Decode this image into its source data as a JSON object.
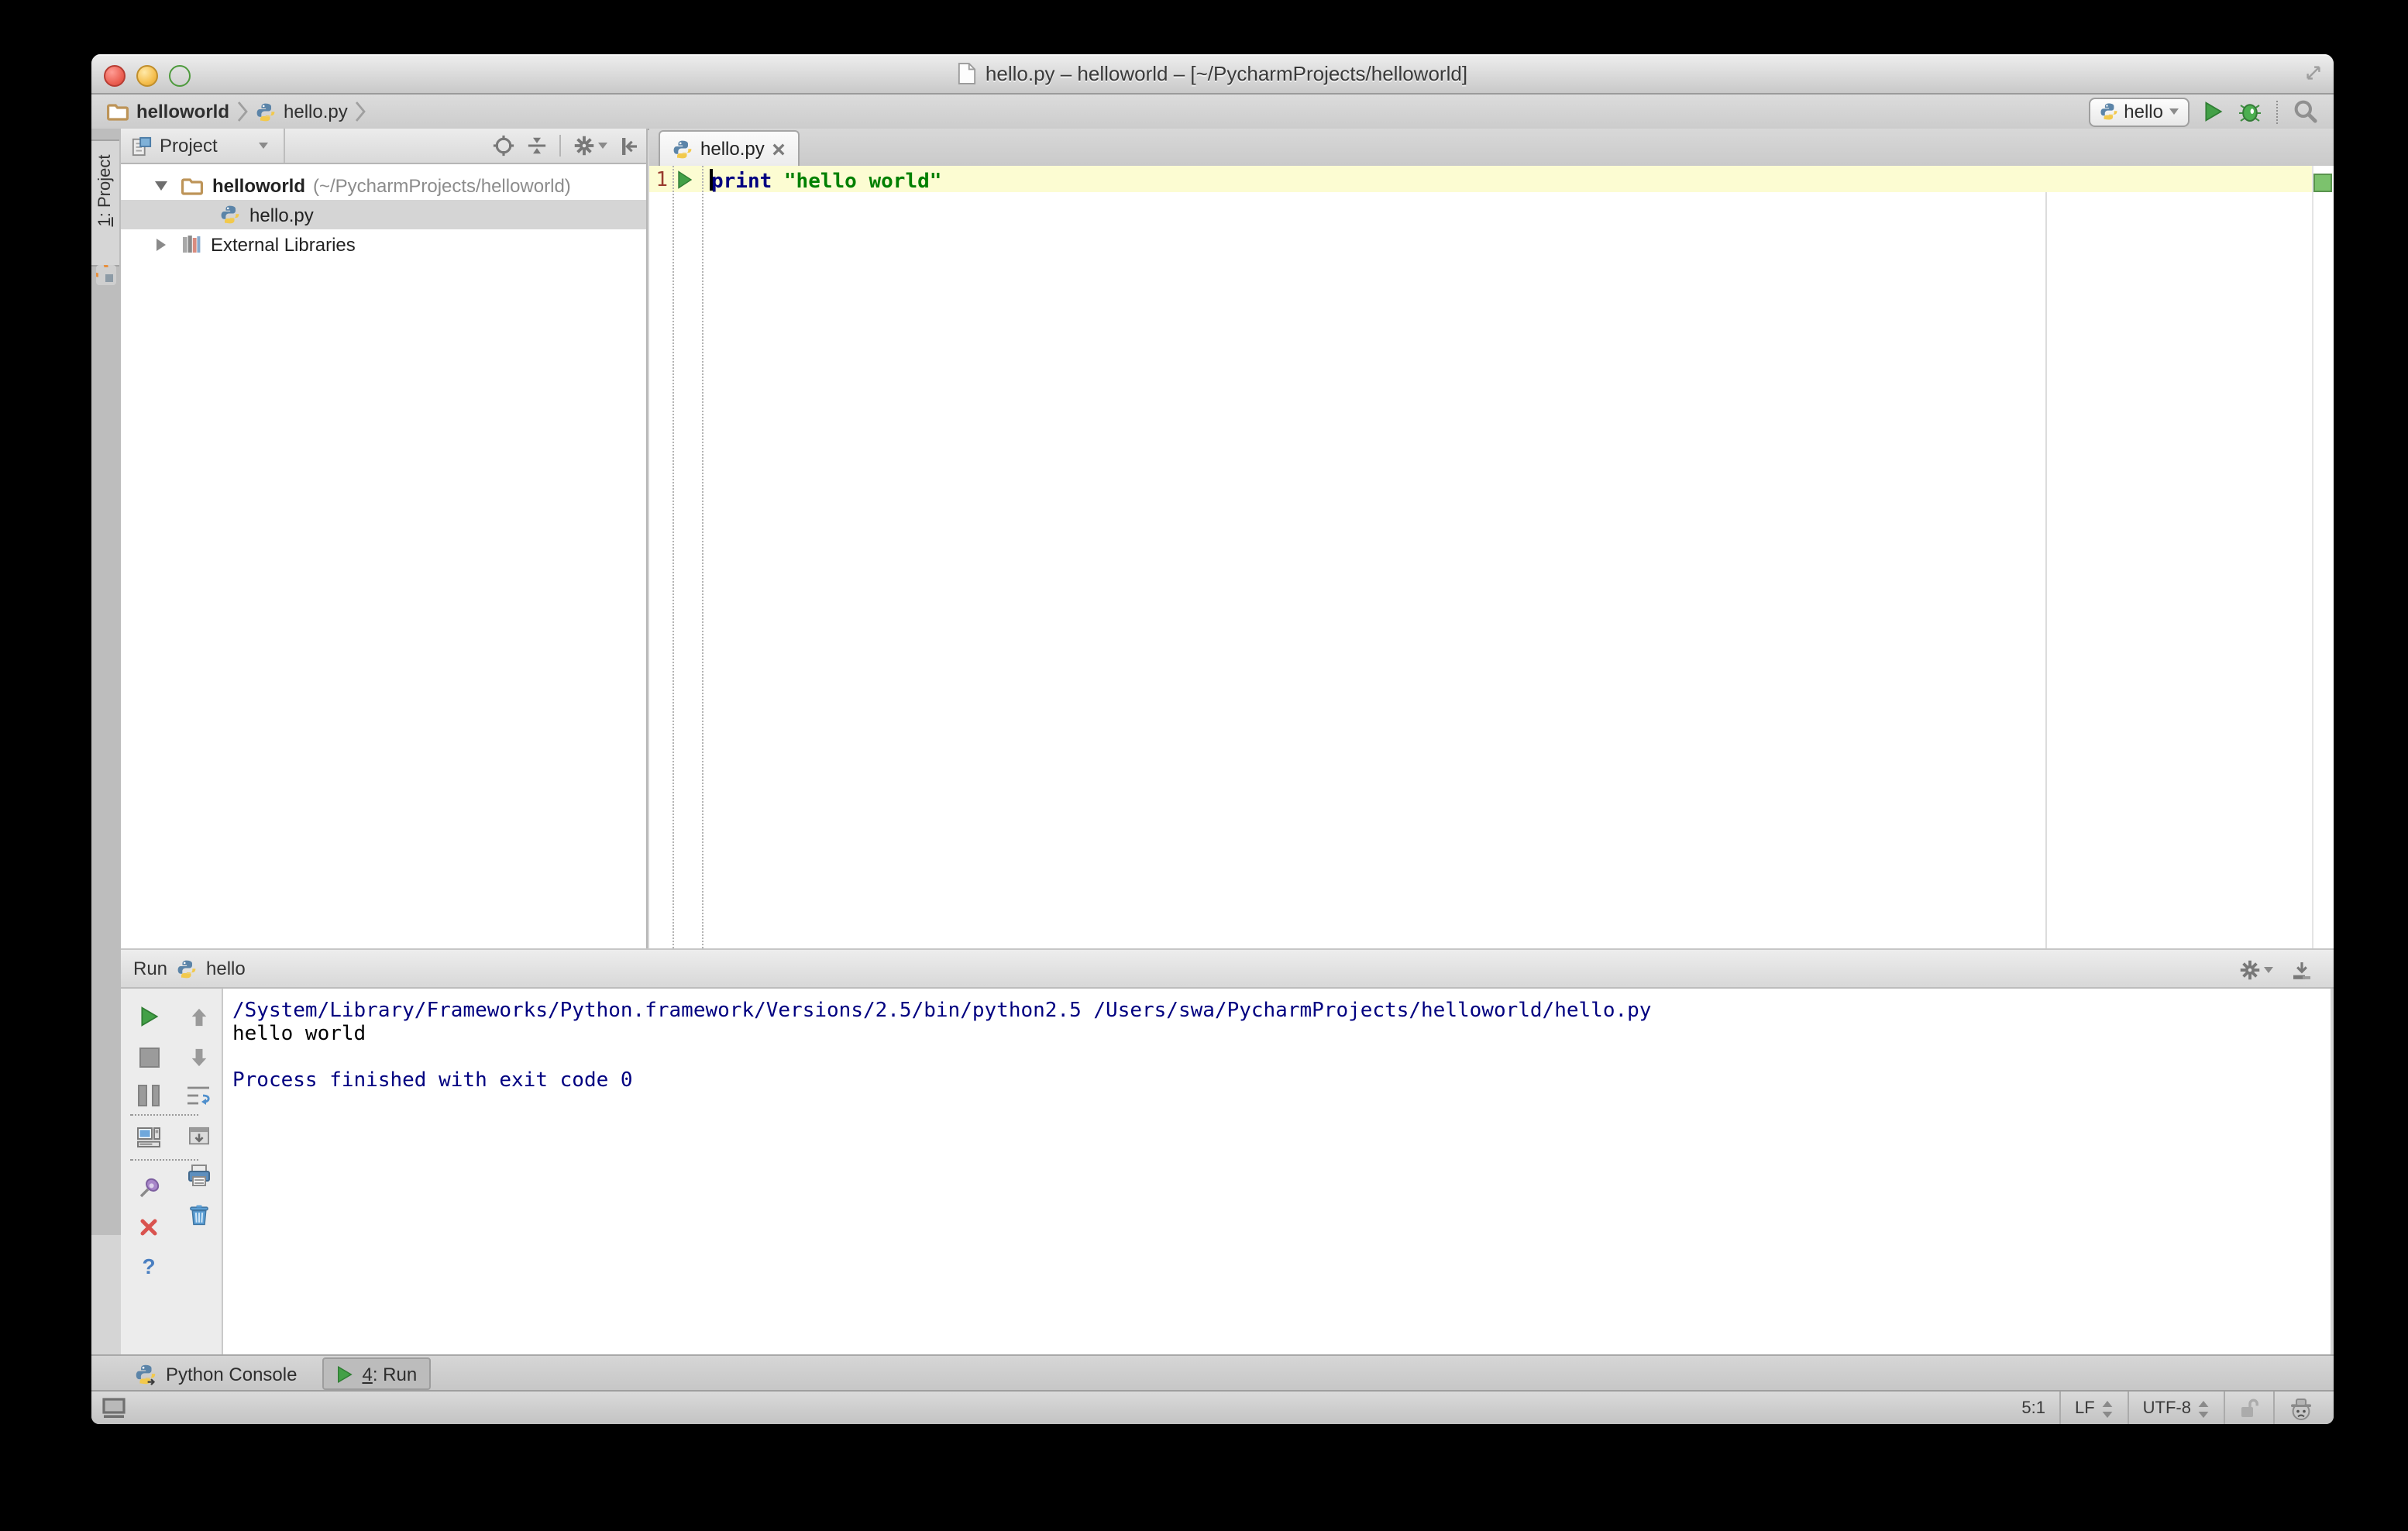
{
  "window": {
    "title": "hello.py – helloworld – [~/PycharmProjects/helloworld]"
  },
  "navbar": {
    "breadcrumbs": [
      {
        "label": "helloworld"
      },
      {
        "label": "hello.py"
      }
    ],
    "run_config": {
      "label": "hello"
    }
  },
  "tool_stripe": {
    "project_tab": {
      "num": "1",
      "rest": ": Project"
    }
  },
  "project_panel": {
    "header": {
      "title": "Project"
    },
    "tree": [
      {
        "label": "helloworld",
        "path": "(~/PycharmProjects/helloworld)"
      },
      {
        "label": "hello.py"
      },
      {
        "label": "External Libraries"
      }
    ]
  },
  "editor": {
    "tab": {
      "label": "hello.py"
    },
    "line_number": "1",
    "code": {
      "keyword": "print",
      "string": "\"hello world\""
    }
  },
  "run_panel": {
    "header": {
      "label": "Run",
      "config": "hello"
    },
    "console": {
      "lines": [
        {
          "text": "/System/Library/Frameworks/Python.framework/Versions/2.5/bin/python2.5 /Users/swa/PycharmProjects/helloworld/hello.py",
          "color": "#000080"
        },
        {
          "text": "hello world",
          "color": "#000000"
        },
        {
          "text": "",
          "color": "#000000"
        },
        {
          "text": "Process finished with exit code 0",
          "color": "#000080"
        }
      ]
    }
  },
  "toolwindow_bar": {
    "python_console_tab": {
      "label": "Python Console"
    },
    "run_tab": {
      "num": "4",
      "rest": ": Run"
    }
  },
  "status_bar": {
    "caret_position": "5:1",
    "line_ending": "LF",
    "encoding": "UTF-8"
  },
  "icons": {
    "run": "green-triangle",
    "debug": "green-bug",
    "search": "magnifier",
    "settings": "gear",
    "python": "blue-yellow-snakes",
    "folder": "tan-folder",
    "libraries": "book-stack",
    "inspection_status": "green-square",
    "lock": "unlocked-padlock",
    "inspector": "hector-face"
  },
  "colors": {
    "keyword": "#000080",
    "string": "#008000",
    "current_line": "#fcfcd2",
    "selection": "#d5d5d5",
    "run_green": "#43a047",
    "console_system": "#000080"
  }
}
